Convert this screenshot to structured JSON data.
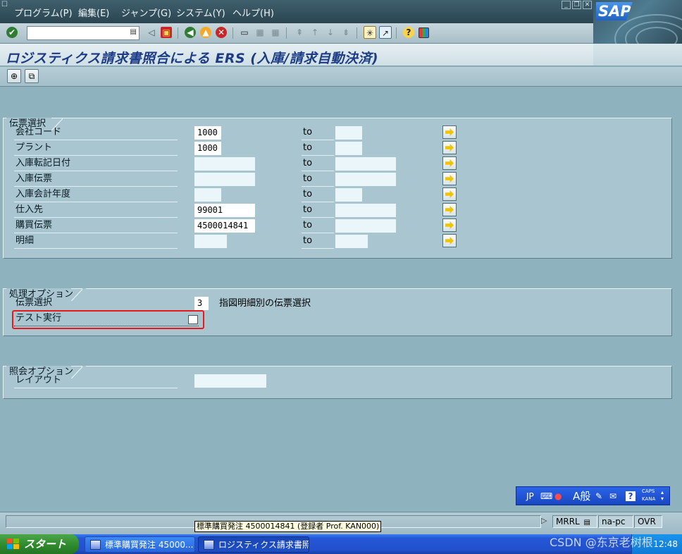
{
  "menu": {
    "items": [
      "プログラム(P)",
      "編集(E)",
      "ジャンプ(G)",
      "システム(Y)",
      "ヘルプ(H)"
    ]
  },
  "brand": {
    "logo_text": "SAP",
    "accent": "#1f63c4"
  },
  "toolbar": {
    "command_value": "",
    "icons": [
      "enter-icon",
      "back-icon",
      "save-icon",
      "back-green-icon",
      "exit-icon",
      "cancel-icon",
      "print-icon",
      "find-icon",
      "find-next-icon",
      "first-page-icon",
      "prev-page-icon",
      "next-page-icon",
      "last-page-icon",
      "new-session-icon",
      "shortcut-icon",
      "help-icon",
      "layout-icon"
    ]
  },
  "title": "ロジスティクス請求書照合による ERS (入庫/請求自動決済)",
  "app_toolbar": {
    "icons": [
      "execute-icon",
      "variant-icon"
    ]
  },
  "document_selection": {
    "title": "伝票選択",
    "to_label": "to",
    "rows": [
      {
        "label": "会社コード",
        "from": "1000",
        "to": ""
      },
      {
        "label": "プラント",
        "from": "1000",
        "to": ""
      },
      {
        "label": "入庫転記日付",
        "from": "",
        "to": ""
      },
      {
        "label": "入庫伝票",
        "from": "",
        "to": ""
      },
      {
        "label": "入庫会計年度",
        "from": "",
        "to": ""
      },
      {
        "label": "仕入先",
        "from": "99001",
        "to": ""
      },
      {
        "label": "購買伝票",
        "from": "4500014841",
        "to": ""
      },
      {
        "label": "明細",
        "from": "",
        "to": ""
      }
    ]
  },
  "processing_options": {
    "title": "処理オプション",
    "doc_select_label": "伝票選択",
    "doc_select_value": "3",
    "doc_select_desc": "指図明細別の伝票選択",
    "test_run_label": "テスト実行",
    "test_run_checked": false,
    "highlight_color": "#e6191d"
  },
  "display_options": {
    "title": "照会オプション",
    "layout_label": "レイアウト",
    "layout_value": ""
  },
  "ime": {
    "lang": "JP",
    "mode": "A般",
    "caps": "CAPS",
    "kana": "KANA"
  },
  "status": {
    "message": "",
    "fields": [
      "MRRL",
      "na-pc",
      "OVR"
    ],
    "tooltip": "標準購買発注 4500014841 (登録者 Prof. KAN000)"
  },
  "taskbar": {
    "start_label": "スタート",
    "tasks": [
      "標準購買発注 45000...",
      "ロジスティクス請求書照..."
    ],
    "clock": "12:48"
  },
  "watermark": "CSDN @东京老树根"
}
